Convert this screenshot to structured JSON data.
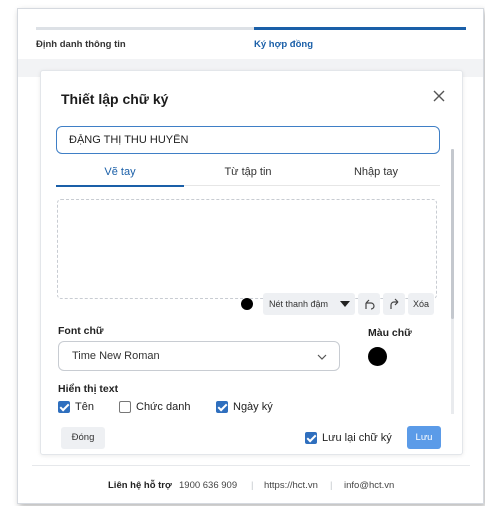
{
  "stepper": {
    "steps": [
      {
        "label": "Định danh thông tin",
        "active": false
      },
      {
        "label": "Ký hợp đồng",
        "active": true
      }
    ]
  },
  "modal": {
    "title": "Thiết lập chữ ký",
    "close_icon": "close-icon",
    "name_value": "ĐẶNG THỊ THU HUYỀN",
    "tabs": [
      {
        "label": "Vẽ tay",
        "active": true
      },
      {
        "label": "Từ tập tin",
        "active": false
      },
      {
        "label": "Nhập tay",
        "active": false
      }
    ],
    "toolbar": {
      "stroke_label": "Nét thanh đậm",
      "undo_icon": "undo-icon",
      "redo_icon": "redo-icon",
      "clear_label": "Xóa"
    },
    "font_label": "Font chữ",
    "font_value": "Time New Roman",
    "color_label": "Màu chữ",
    "color_value": "#000000",
    "display_label": "Hiển thị text",
    "checkboxes": [
      {
        "label": "Tên",
        "checked": true
      },
      {
        "label": "Chức danh",
        "checked": false
      },
      {
        "label": "Ngày ký",
        "checked": true
      }
    ],
    "close_button": "Đóng",
    "save_signature_label": "Lưu lại chữ ký",
    "save_signature_checked": true,
    "save_button": "Lưu"
  },
  "footer": {
    "support_label": "Liên hệ hỗ trợ",
    "phone": "1900 636 909",
    "separator": "|",
    "website": "https://hct.vn",
    "email": "info@hct.vn"
  },
  "colors": {
    "primary": "#1a5fa8",
    "save_button": "#5b9be8",
    "checkbox": "#2f6fbe"
  }
}
